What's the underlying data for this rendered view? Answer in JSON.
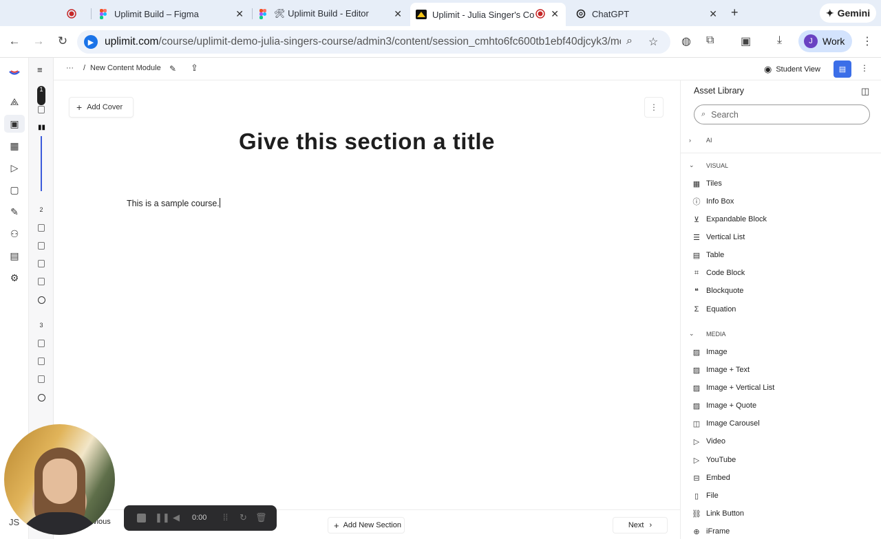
{
  "browser": {
    "tabs": [
      {
        "title": "",
        "icon": "record-icon"
      },
      {
        "title": "Uplimit Build – Figma",
        "icon": "figma-icon"
      },
      {
        "title": "🛠 Uplimit Build - Editor Block",
        "icon": "figma-icon"
      },
      {
        "title": "Uplimit - Julia Singer's Co",
        "icon": "uplimit-icon",
        "active": true
      },
      {
        "title": "ChatGPT",
        "icon": "chatgpt-icon"
      }
    ],
    "gemini_label": "Gemini",
    "url_host": "uplimit.com",
    "url_path": "/course/uplimit-demo-julia-singers-course/admin3/content/session_cmhto6fc600tb1ebf40djcyk3/mod...",
    "profile_initial": "J",
    "profile_label": "Work"
  },
  "editor": {
    "breadcrumb_more": "···",
    "breadcrumb_sep": "/",
    "module_name": "New Content Module",
    "student_view_label": "Student View",
    "add_cover_label": "Add Cover",
    "section_title": "Give this section a title",
    "body_text": "This is a sample course.",
    "previous_label": "Previous",
    "add_section_label": "Add New Section",
    "next_label": "Next",
    "user_initials": "JS"
  },
  "outline": {
    "sections": [
      "1",
      "2",
      "3"
    ]
  },
  "asset_library": {
    "title": "Asset Library",
    "search_placeholder": "Search",
    "categories": {
      "ai": "AI",
      "visual": "VISUAL",
      "media": "MEDIA"
    },
    "visual_items": [
      "Tiles",
      "Info Box",
      "Expandable Block",
      "Vertical List",
      "Table",
      "Code Block",
      "Blockquote",
      "Equation"
    ],
    "media_items": [
      "Image",
      "Image + Text",
      "Image + Vertical List",
      "Image + Quote",
      "Image Carousel",
      "Video",
      "YouTube",
      "Embed",
      "File",
      "Link Button",
      "iFrame"
    ]
  },
  "recorder": {
    "time": "0:00"
  },
  "colors": {
    "accent": "#3b6ee8",
    "tabbar": "#e7eef8",
    "omnibox": "#edf2fa"
  }
}
